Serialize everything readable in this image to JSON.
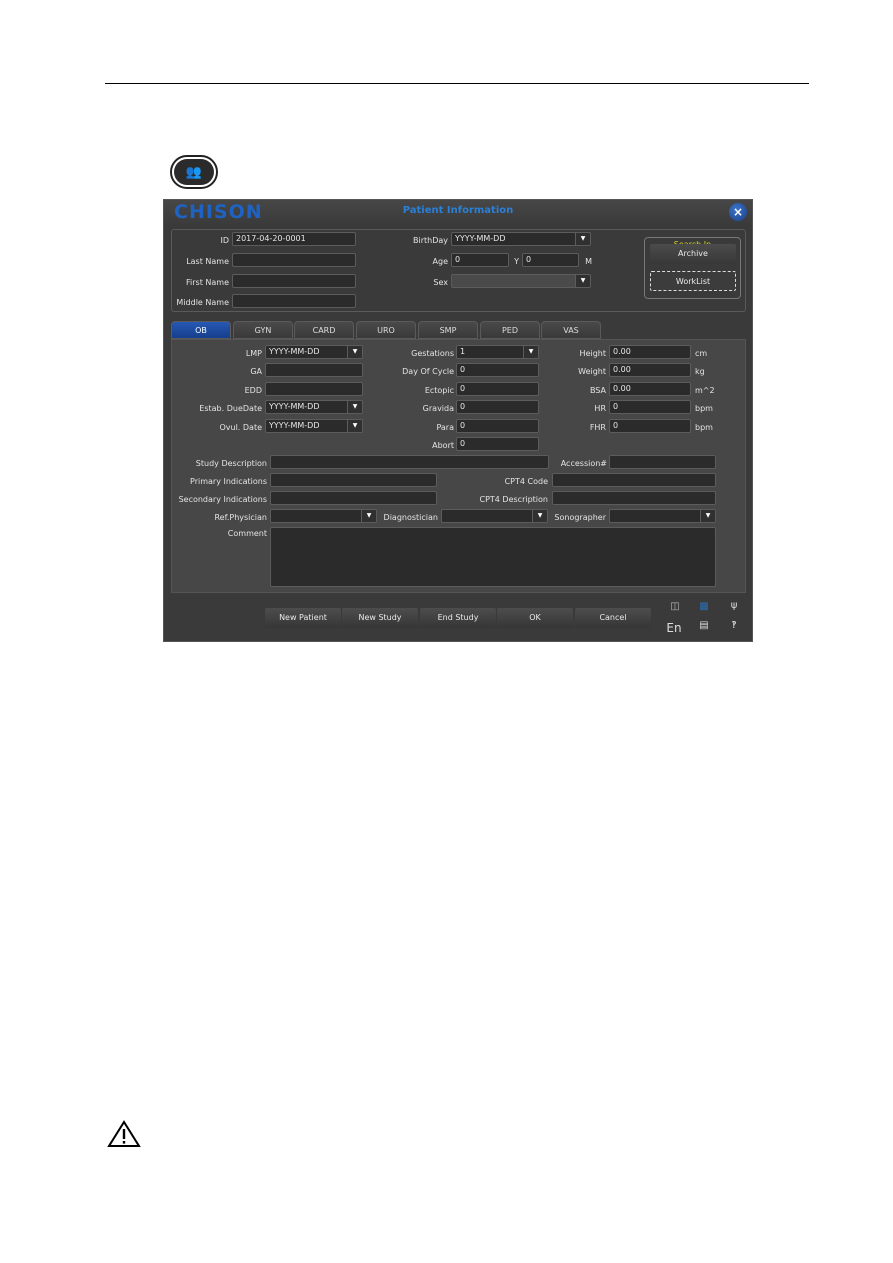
{
  "page": {
    "patient_key_icon": "patient-key-icon",
    "warning_icon": "warning-triangle-icon"
  },
  "dialog": {
    "logo": "CHISON",
    "title": "Patient Information",
    "close_icon": "×",
    "patient": {
      "id_label": "ID",
      "id_value": "2017-04-20-0001",
      "last_name_label": "Last Name",
      "last_name_value": "",
      "first_name_label": "First Name",
      "first_name_value": "",
      "middle_name_label": "Middle Name",
      "middle_name_value": "",
      "birthday_label": "BirthDay",
      "birthday_value": "YYYY-MM-DD",
      "age_label": "Age",
      "age_years": "0",
      "age_y_unit": "Y",
      "age_months": "0",
      "age_m_unit": "M",
      "sex_label": "Sex",
      "sex_value": ""
    },
    "search_in": {
      "legend": "Search In",
      "archive": "Archive",
      "worklist": "WorkList"
    },
    "tabs": [
      {
        "label": "OB",
        "active": true
      },
      {
        "label": "GYN"
      },
      {
        "label": "CARD"
      },
      {
        "label": "URO"
      },
      {
        "label": "SMP"
      },
      {
        "label": "PED"
      },
      {
        "label": "VAS"
      }
    ],
    "ob": {
      "lmp_label": "LMP",
      "lmp_value": "YYYY-MM-DD",
      "ga_label": "GA",
      "ga_value": "",
      "edd_label": "EDD",
      "edd_value": "",
      "estab_label": "Estab. DueDate",
      "estab_value": "YYYY-MM-DD",
      "ovul_label": "Ovul. Date",
      "ovul_value": "YYYY-MM-DD",
      "gestations_label": "Gestations",
      "gestations_value": "1",
      "doc_label": "Day Of Cycle",
      "doc_value": "0",
      "ectopic_label": "Ectopic",
      "ectopic_value": "0",
      "gravida_label": "Gravida",
      "gravida_value": "0",
      "para_label": "Para",
      "para_value": "0",
      "abort_label": "Abort",
      "abort_value": "0",
      "height_label": "Height",
      "height_value": "0.00",
      "height_unit": "cm",
      "weight_label": "Weight",
      "weight_value": "0.00",
      "weight_unit": "kg",
      "bsa_label": "BSA",
      "bsa_value": "0.00",
      "bsa_unit": "m^2",
      "hr_label": "HR",
      "hr_value": "0",
      "hr_unit": "bpm",
      "fhr_label": "FHR",
      "fhr_value": "0",
      "fhr_unit": "bpm"
    },
    "study": {
      "study_desc_label": "Study Description",
      "study_desc_value": "",
      "accession_label": "Accession#",
      "accession_value": "",
      "primary_label": "Primary Indications",
      "primary_value": "",
      "cpt4_code_label": "CPT4 Code",
      "cpt4_code_value": "",
      "secondary_label": "Secondary Indications",
      "secondary_value": "",
      "cpt4_desc_label": "CPT4 Description",
      "cpt4_desc_value": "",
      "ref_label": "Ref.Physician",
      "ref_value": "",
      "diag_label": "Diagnostician",
      "diag_value": "",
      "sono_label": "Sonographer",
      "sono_value": "",
      "comment_label": "Comment",
      "comment_value": ""
    },
    "buttons": {
      "new_patient": "New Patient",
      "new_study": "New Study",
      "end_study": "End Study",
      "ok": "OK",
      "cancel": "Cancel"
    },
    "status": {
      "language": "En"
    }
  }
}
